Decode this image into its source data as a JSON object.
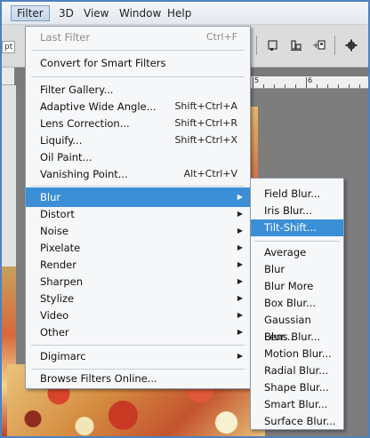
{
  "menubar": {
    "items": [
      "Filter",
      "3D",
      "View",
      "Window",
      "Help"
    ]
  },
  "optbar": {
    "pt_label": "pt",
    "icons": [
      "align-icon",
      "distribute-icon",
      "arrange-icon",
      "gear-icon"
    ]
  },
  "ruler": {
    "labels": [
      "5",
      "6"
    ]
  },
  "filter_menu": {
    "items": [
      {
        "label": "Last Filter",
        "shortcut": "Ctrl+F",
        "disabled": true
      },
      {
        "label": "Convert for Smart Filters"
      },
      {
        "label": "Filter Gallery..."
      },
      {
        "label": "Adaptive Wide Angle...",
        "shortcut": "Shift+Ctrl+A"
      },
      {
        "label": "Lens Correction...",
        "shortcut": "Shift+Ctrl+R"
      },
      {
        "label": "Liquify...",
        "shortcut": "Shift+Ctrl+X"
      },
      {
        "label": "Oil Paint..."
      },
      {
        "label": "Vanishing Point...",
        "shortcut": "Alt+Ctrl+V"
      },
      {
        "label": "Blur",
        "submenu": true,
        "highlighted": true
      },
      {
        "label": "Distort",
        "submenu": true
      },
      {
        "label": "Noise",
        "submenu": true
      },
      {
        "label": "Pixelate",
        "submenu": true
      },
      {
        "label": "Render",
        "submenu": true
      },
      {
        "label": "Sharpen",
        "submenu": true
      },
      {
        "label": "Stylize",
        "submenu": true
      },
      {
        "label": "Video",
        "submenu": true
      },
      {
        "label": "Other",
        "submenu": true
      },
      {
        "label": "Digimarc",
        "submenu": true
      },
      {
        "label": "Browse Filters Online..."
      }
    ]
  },
  "blur_submenu": {
    "items": [
      {
        "label": "Field Blur..."
      },
      {
        "label": "Iris Blur..."
      },
      {
        "label": "Tilt-Shift...",
        "highlighted": true
      },
      {
        "label": "Average"
      },
      {
        "label": "Blur"
      },
      {
        "label": "Blur More"
      },
      {
        "label": "Box Blur..."
      },
      {
        "label": "Gaussian Blur..."
      },
      {
        "label": "Lens Blur..."
      },
      {
        "label": "Motion Blur..."
      },
      {
        "label": "Radial Blur..."
      },
      {
        "label": "Shape Blur..."
      },
      {
        "label": "Smart Blur..."
      },
      {
        "label": "Surface Blur..."
      }
    ]
  },
  "colors": {
    "highlight": "#3b8fd6",
    "frame": "#4f81bd"
  }
}
